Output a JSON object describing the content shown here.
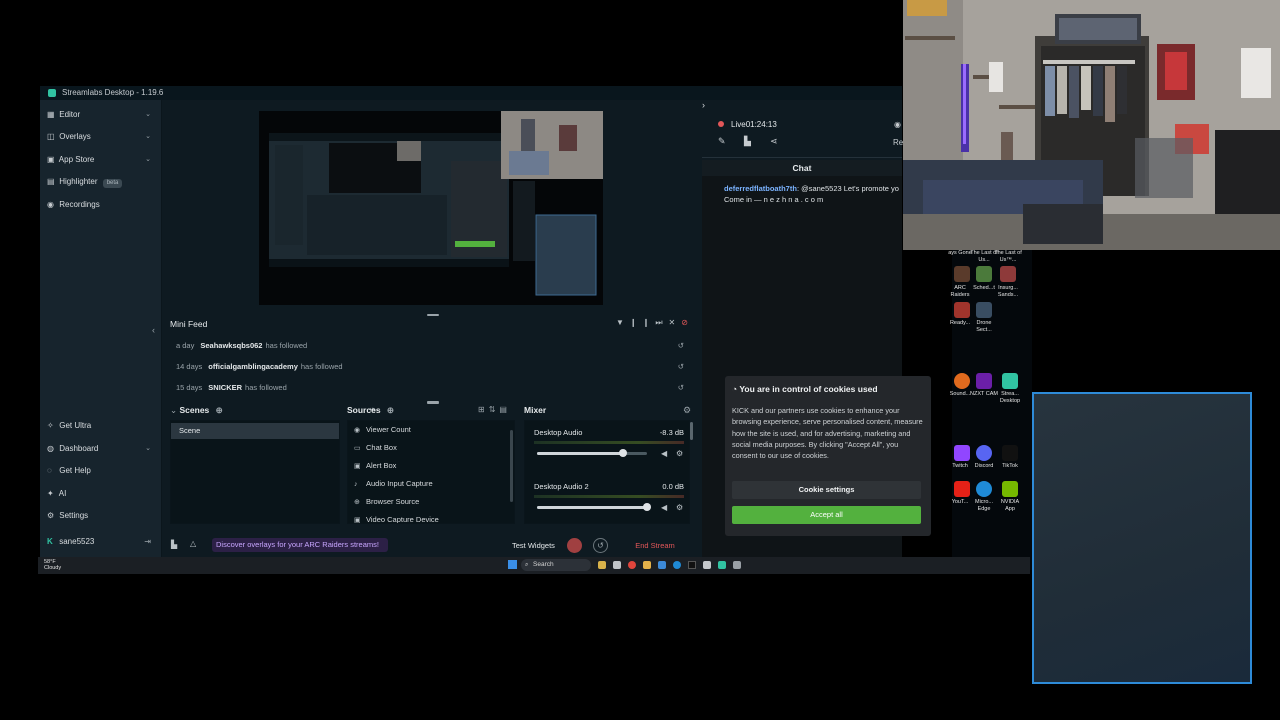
{
  "window": {
    "title": "Streamlabs Desktop - 1.19.6"
  },
  "sidebar": {
    "items": [
      {
        "label": "Editor"
      },
      {
        "label": "Overlays"
      },
      {
        "label": "App Store"
      },
      {
        "label": "Highlighter",
        "badge": "beta"
      },
      {
        "label": "Recordings"
      }
    ],
    "bottom_items": [
      {
        "label": "Get Ultra"
      },
      {
        "label": "Dashboard"
      },
      {
        "label": "Get Help"
      },
      {
        "label": "AI"
      },
      {
        "label": "Settings"
      }
    ],
    "user": "sane5523"
  },
  "mini_feed": {
    "title": "Mini Feed",
    "events": [
      {
        "time": "a day",
        "user": "Seahawksqbs062",
        "action": "has followed"
      },
      {
        "time": "14 days",
        "user": "officialgamblingacademy",
        "action": "has followed"
      },
      {
        "time": "15 days",
        "user": "SNICKER",
        "action": "has followed"
      }
    ]
  },
  "scenes": {
    "title": "Scenes",
    "items": [
      "Scene"
    ]
  },
  "sources": {
    "title": "Sources",
    "items": [
      "Viewer Count",
      "Chat Box",
      "Alert Box",
      "Audio Input Capture",
      "Browser Source",
      "Video Capture Device"
    ]
  },
  "mixer": {
    "title": "Mixer",
    "channels": [
      {
        "name": "Desktop Audio",
        "db": "-8.3 dB",
        "level": 0.78
      },
      {
        "name": "Desktop Audio 2",
        "db": "0.0 dB",
        "level": 1.0
      }
    ]
  },
  "footer": {
    "promo": "Discover overlays for your ARC Raiders streams!",
    "test_widgets": "Test Widgets",
    "end_stream": "End Stream"
  },
  "live": {
    "label": "Live",
    "time": "01:24:13",
    "right_cut": "Re"
  },
  "chat": {
    "title": "Chat",
    "messages": [
      {
        "user": "deferredflatboath7th",
        "text": ": @sane5523 Let's promote yo",
        "line2": "Come in — n e z h n a . c o m"
      }
    ]
  },
  "cookie": {
    "title": "You are in control of cookies used",
    "body": "KICK and our partners use cookies to enhance your browsing experience, serve personalised content, measure how the site is used, and for advertising, marketing and social media purposes. By clicking \"Accept All\", you consent to our use of cookies.",
    "settings": "Cookie settings",
    "accept": "Accept all"
  },
  "taskbar": {
    "search": "Search",
    "weather_temp": "58°F",
    "weather_cond": "Cloudy"
  },
  "desktop_icons": [
    {
      "label": "ays Gone"
    },
    {
      "label": "The Last of Us..."
    },
    {
      "label": "The Last of Us™..."
    },
    {
      "label": "ARC Raiders"
    },
    {
      "label": "Sched...t"
    },
    {
      "label": "Insurg... Sands..."
    },
    {
      "label": "Ready..."
    },
    {
      "label": "Drone Sect..."
    },
    {
      "label": "Sound..."
    },
    {
      "label": "NZXT CAM"
    },
    {
      "label": "Strea... Desktop"
    },
    {
      "label": "Twitch"
    },
    {
      "label": "Discord"
    },
    {
      "label": "TikTok"
    },
    {
      "label": "YouT..."
    },
    {
      "label": "Micro... Edge"
    },
    {
      "label": "NVIDIA App"
    }
  ],
  "colors": {
    "accent": "#31c3a2",
    "end_stream": "#e25759",
    "accept": "#53b13e",
    "live": "#e25759",
    "promo_bg": "#2c2046",
    "promo_text": "#c8a6ff"
  }
}
